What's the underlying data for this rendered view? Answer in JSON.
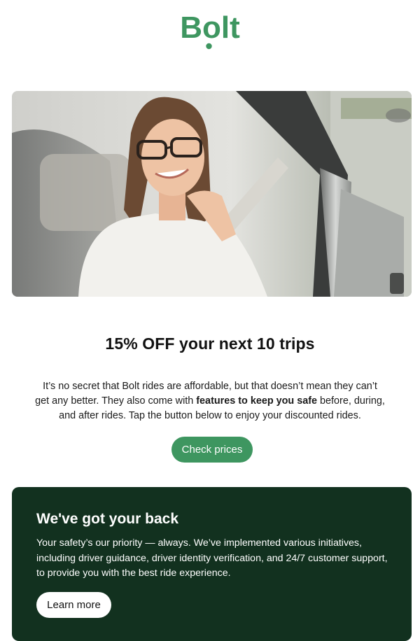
{
  "brand": {
    "logo_text": "Bolt",
    "color": "#3e9660"
  },
  "hero": {
    "image": "woman-in-car-back-seat-photo"
  },
  "offer": {
    "headline": "15% OFF your next 10 trips",
    "body_part1": "It’s no secret that Bolt rides are affordable, but that doesn’t mean they can’t get any better. They also come with ",
    "body_bold": "features to keep you safe",
    "body_part2": " before, during, and after rides. Tap the button below to enjoy your discounted rides.",
    "cta_label": "Check prices"
  },
  "safety": {
    "title": "We've got your back",
    "text": "Your safety’s our priority — always. We’ve implemented various initiatives, including driver guidance, driver identity verification, and 24/7 customer support, to provide you with the best ride experience.",
    "cta_label": "Learn more",
    "background": "#12311f"
  }
}
